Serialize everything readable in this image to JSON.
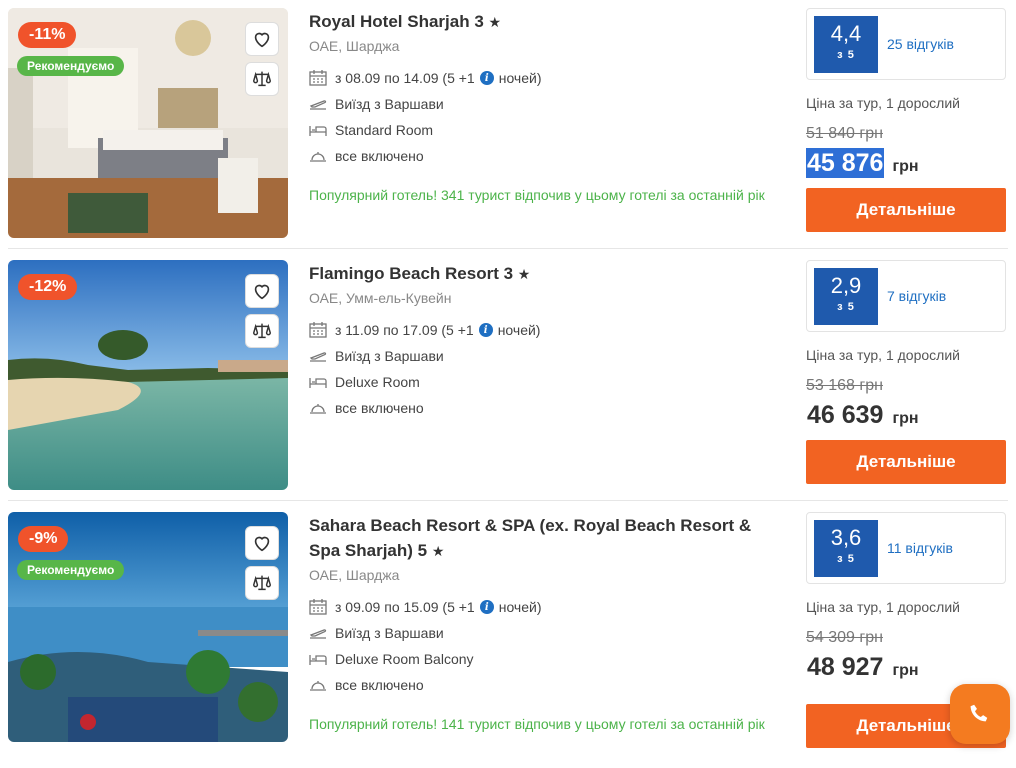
{
  "colors": {
    "accent": "#f26322",
    "score_bg": "#1f5aad",
    "recommend": "#58b648",
    "discount": "#f0532b",
    "popular": "#4cb34a"
  },
  "hotels": [
    {
      "discount": "-11%",
      "recommended_label": "Рекомендуємо",
      "name": "Royal Hotel Sharjah 3",
      "star_icon": "★",
      "location": "ОАЕ, Шарджа",
      "dates_text": "з 08.09 по 14.09 (5 +1",
      "nights_text": "ночей)",
      "departure": "Виїзд з Варшави",
      "room": "Standard Room",
      "meal": "все включено",
      "popular": "Популярний готель! 341 турист відпочив у цьому готелі за останній рік",
      "score": "4,4",
      "score_of": "з 5",
      "reviews": "25 відгуків",
      "price_label": "Ціна за тур, 1 дорослий",
      "old_price": "51 840 грн",
      "new_price": "45 876",
      "currency": "грн",
      "button": "Детальніше"
    },
    {
      "discount": "-12%",
      "recommended_label": "",
      "name": "Flamingo Beach Resort 3",
      "star_icon": "★",
      "location": "ОАЕ, Умм-ель-Кувейн",
      "dates_text": "з 11.09 по 17.09 (5 +1",
      "nights_text": "ночей)",
      "departure": "Виїзд з Варшави",
      "room": "Deluxe Room",
      "meal": "все включено",
      "popular": "",
      "score": "2,9",
      "score_of": "з 5",
      "reviews": "7 відгуків",
      "price_label": "Ціна за тур, 1 дорослий",
      "old_price": "53 168 грн",
      "new_price": "46 639",
      "currency": "грн",
      "button": "Детальніше"
    },
    {
      "discount": "-9%",
      "recommended_label": "Рекомендуємо",
      "name": "Sahara Beach Resort & SPA (ex. Royal Beach Resort & Spa Sharjah) 5",
      "star_icon": "★",
      "location": "ОАЕ, Шарджа",
      "dates_text": "з 09.09 по 15.09 (5 +1",
      "nights_text": "ночей)",
      "departure": "Виїзд з Варшави",
      "room": "Deluxe Room Balcony",
      "meal": "все включено",
      "popular": "Популярний готель! 141 турист відпочив у цьому готелі за останній рік",
      "score": "3,6",
      "score_of": "з 5",
      "reviews": "11 відгуків",
      "price_label": "Ціна за тур, 1 дорослий",
      "old_price": "54 309 грн",
      "new_price": "48 927",
      "currency": "грн",
      "button": "Детальніше"
    }
  ],
  "icons": {
    "favorite": "heart-icon",
    "compare": "scales-icon",
    "calendar": "calendar-icon",
    "plane": "plane-icon",
    "bed": "bed-icon",
    "meal": "cloche-icon",
    "call": "phone-icon"
  }
}
